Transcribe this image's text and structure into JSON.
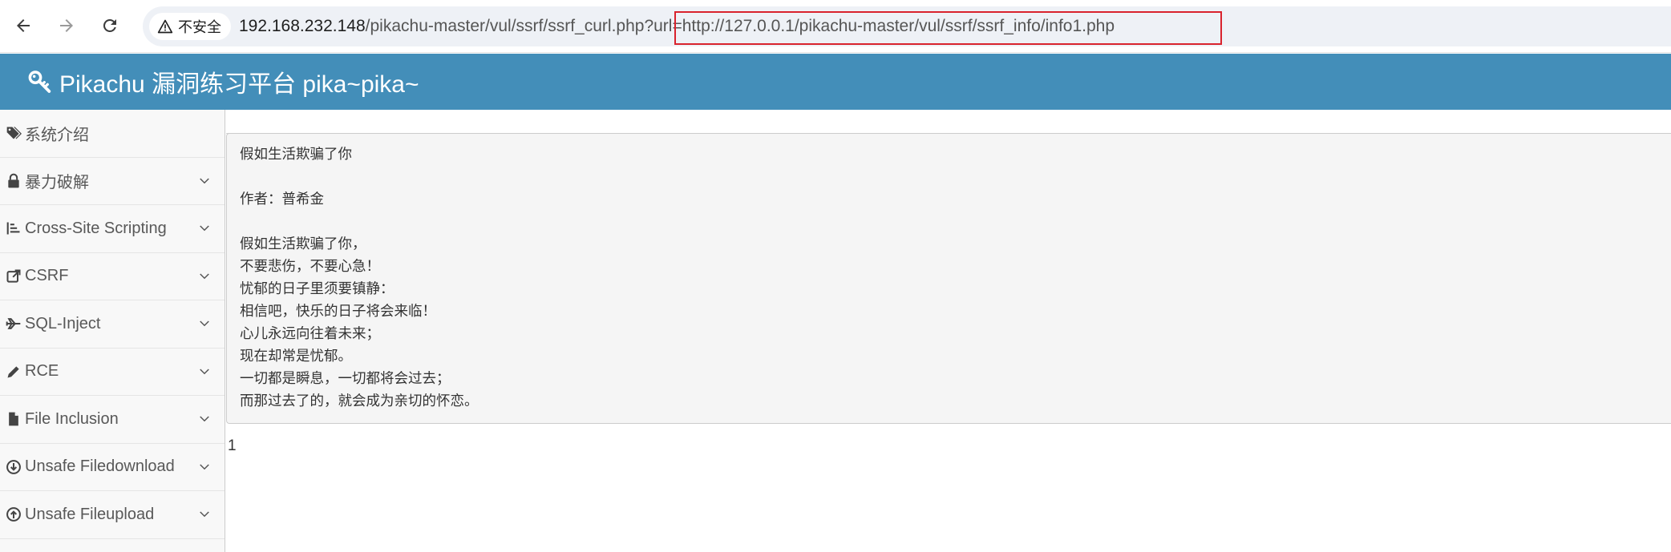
{
  "browser": {
    "security_label": "不安全",
    "url_host": "192.168.232.148",
    "url_path": "/pikachu-master/vul/ssrf/ssrf_curl.php",
    "url_query": "?url=http://127.0.0.1/pikachu-master/vul/ssrf/ssrf_info/info1.php",
    "highlight_color": "#d9232d"
  },
  "header": {
    "title": "Pikachu 漏洞练习平台 pika~pika~",
    "background": "#438eb9",
    "icon": "key-icon"
  },
  "sidebar": {
    "items": [
      {
        "label": "系统介绍",
        "icon": "tags-icon",
        "expandable": false
      },
      {
        "label": "暴力破解",
        "icon": "lock-icon",
        "expandable": true
      },
      {
        "label": "Cross-Site Scripting",
        "icon": "list-icon",
        "expandable": true
      },
      {
        "label": "CSRF",
        "icon": "share-icon",
        "expandable": true
      },
      {
        "label": "SQL-Inject",
        "icon": "plane-icon",
        "expandable": true
      },
      {
        "label": "RCE",
        "icon": "pencil-icon",
        "expandable": true
      },
      {
        "label": "File Inclusion",
        "icon": "file-icon",
        "expandable": true
      },
      {
        "label": "Unsafe Filedownload",
        "icon": "download-icon",
        "expandable": true
      },
      {
        "label": "Unsafe Fileupload",
        "icon": "upload-icon",
        "expandable": true
      }
    ]
  },
  "poem": {
    "title": "假如生活欺骗了你",
    "author": "作者：普希金",
    "lines": [
      "假如生活欺骗了你，",
      "不要悲伤，不要心急！",
      "忧郁的日子里须要镇静：",
      "相信吧，快乐的日子将会来临！",
      "心儿永远向往着未来；",
      "现在却常是忧郁。",
      "一切都是瞬息，一切都将会过去；",
      "而那过去了的，就会成为亲切的怀恋。"
    ]
  },
  "result": {
    "value": "1"
  }
}
